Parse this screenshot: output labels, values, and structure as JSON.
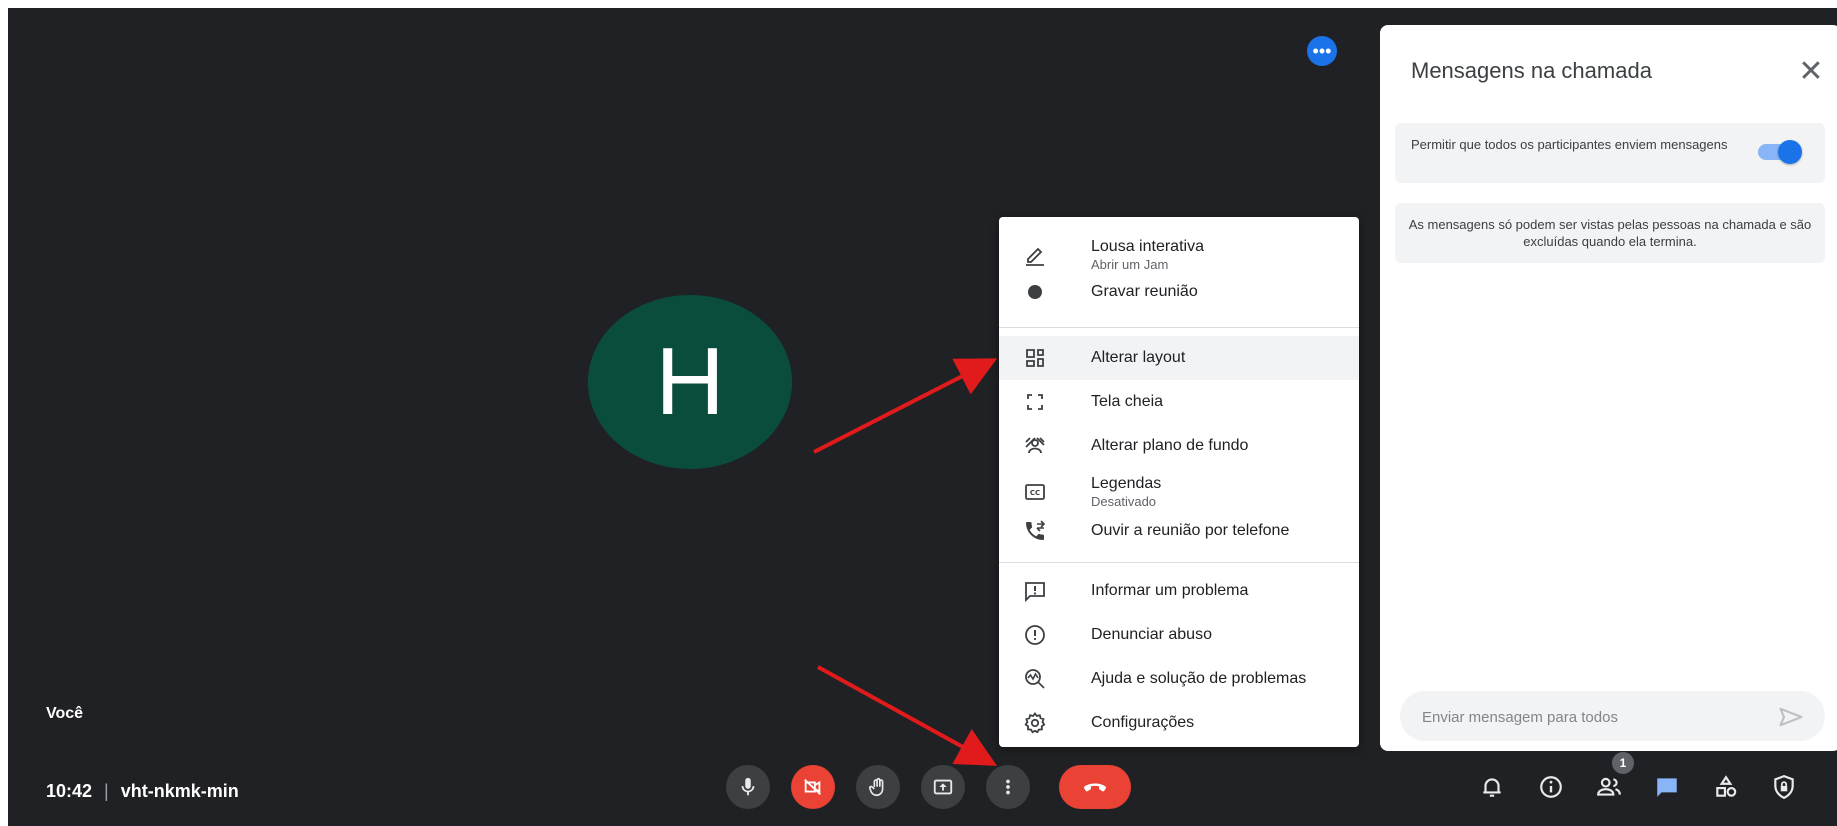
{
  "stage": {
    "avatar_letter": "H",
    "self_label": "Você",
    "avatar_color": "#0b4d3c",
    "tile_more_icon": "more-horiz-icon"
  },
  "meeting": {
    "time": "10:42",
    "code": "vht-nkmk-min"
  },
  "controls": [
    {
      "name": "mic",
      "icon": "mic-icon"
    },
    {
      "name": "camera",
      "icon": "videocam-off-icon",
      "state": "off"
    },
    {
      "name": "raise-hand",
      "icon": "hand-icon"
    },
    {
      "name": "present",
      "icon": "present-screen-icon"
    },
    {
      "name": "more-options",
      "icon": "more-vert-icon"
    },
    {
      "name": "leave-call",
      "icon": "call-end-icon"
    }
  ],
  "right_controls": {
    "participants_badge": "1",
    "icons": [
      "bell-icon",
      "info-icon",
      "people-icon",
      "chat-icon",
      "activities-icon",
      "host-controls-icon"
    ]
  },
  "panel": {
    "title": "Mensagens na chamada",
    "permission_text": "Permitir que todos os participantes enviem mensagens",
    "permission_enabled": true,
    "info_text": "As mensagens só podem ser vistas pelas pessoas na chamada e são excluídas quando ela termina.",
    "input_placeholder": "Enviar mensagem para todos"
  },
  "menu": {
    "items": [
      {
        "label": "Lousa interativa",
        "sub": "Abrir um Jam",
        "icon": "pen-icon"
      },
      {
        "label": "Gravar reunião",
        "icon": "record-icon"
      },
      {
        "label": "Alterar layout",
        "icon": "layout-icon",
        "highlighted": true
      },
      {
        "label": "Tela cheia",
        "icon": "fullscreen-icon"
      },
      {
        "label": "Alterar plano de fundo",
        "icon": "background-icon"
      },
      {
        "label": "Legendas",
        "sub": "Desativado",
        "icon": "captions-icon"
      },
      {
        "label": "Ouvir a reunião por telefone",
        "icon": "phone-forward-icon"
      },
      {
        "label": "Informar um problema",
        "icon": "feedback-icon"
      },
      {
        "label": "Denunciar abuso",
        "icon": "report-icon"
      },
      {
        "label": "Ajuda e solução de problemas",
        "icon": "help-icon"
      },
      {
        "label": "Configurações",
        "icon": "settings-icon"
      }
    ]
  },
  "colors": {
    "background": "#202124",
    "accent": "#1a73e8",
    "danger": "#ea4335",
    "annotation_arrow": "#e11b1b"
  }
}
